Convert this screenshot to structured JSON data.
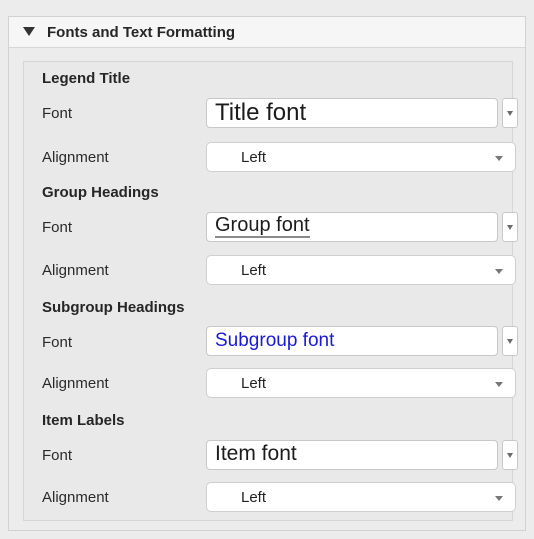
{
  "panel": {
    "title": "Fonts and Text Formatting"
  },
  "sections": [
    {
      "heading": "Legend Title",
      "font_label": "Font",
      "font_value": "Title font",
      "alignment_label": "Alignment",
      "alignment_value": "Left"
    },
    {
      "heading": "Group Headings",
      "font_label": "Font",
      "font_value": "Group font",
      "alignment_label": "Alignment",
      "alignment_value": "Left"
    },
    {
      "heading": "Subgroup Headings",
      "font_label": "Font",
      "font_value": "Subgroup font",
      "alignment_label": "Alignment",
      "alignment_value": "Left"
    },
    {
      "heading": "Item Labels",
      "font_label": "Font",
      "font_value": "Item font",
      "alignment_label": "Alignment",
      "alignment_value": "Left"
    }
  ],
  "colors": {
    "subgroup_font": "#1a1ad6",
    "group_underline": "#8a8a8a"
  },
  "icons": {
    "collapse": "triangle-down-icon",
    "dropdown": "chevron-down-icon"
  }
}
